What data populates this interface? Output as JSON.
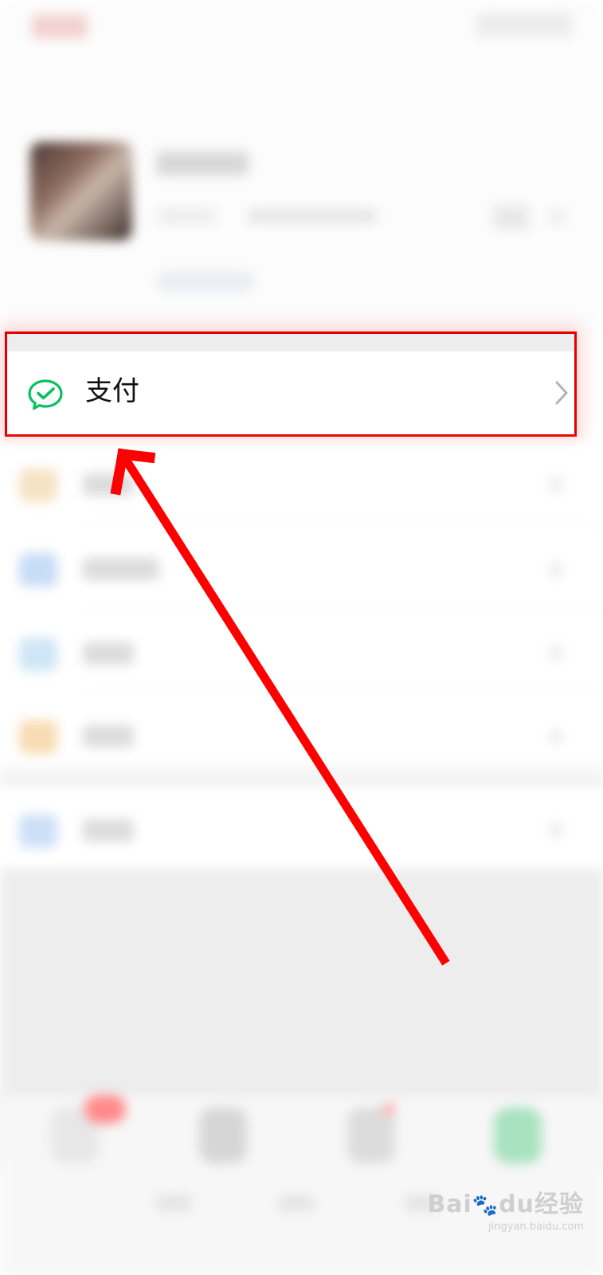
{
  "pay_item": {
    "label": "支付",
    "icon": "wechat-pay-icon",
    "chevron": "chevron-right-icon",
    "accent_color": "#07C160"
  },
  "annotation": {
    "highlight_color": "#E10000",
    "arrow_color": "#FF0000"
  },
  "watermark": {
    "brand": "Bai",
    "brand_suffix": "du",
    "brand_cn": "经验",
    "url": "jingyan.baidu.com"
  }
}
